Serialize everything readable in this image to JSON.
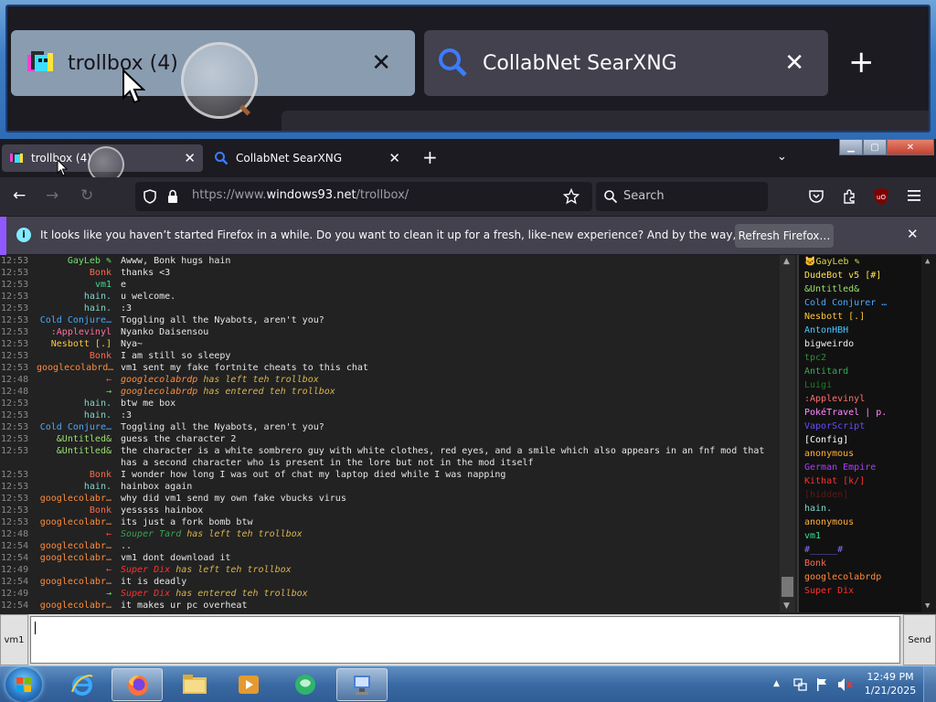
{
  "preview": {
    "tab1_title": "trollbox (4)",
    "tab2_title": "CollabNet SearXNG",
    "close": "✕",
    "newtab": "+"
  },
  "tabs": [
    {
      "title": "trollbox (4)",
      "active": true
    },
    {
      "title": "CollabNet SearXNG",
      "active": false
    }
  ],
  "tab_close": "✕",
  "newtab": "+",
  "listall": "⌄",
  "window_controls": {
    "min": "▁",
    "max": "▢",
    "close": "✕"
  },
  "nav": {
    "back": "←",
    "forward": "→",
    "reload": "↻",
    "url_prefix": "https://www.",
    "url_host": "windows93.net",
    "url_path": "/trollbox/",
    "search_placeholder": "Search"
  },
  "notification": {
    "text": "It looks like you haven’t started Firefox in a while. Do you want to clean it up for a fresh, like-new experience? And by the way, welcome back!",
    "button": "Refresh Firefox…",
    "close": "✕",
    "icon": "i"
  },
  "chat": [
    {
      "time": "12:53",
      "nick": "GayLeb ✎",
      "color": "#6ee06e",
      "text": "Awww, Bonk hugs hain"
    },
    {
      "time": "12:53",
      "nick": "Bonk",
      "color": "#ff6b4a",
      "text": "thanks <3"
    },
    {
      "time": "12:53",
      "nick": "vm1",
      "color": "#3ddc97",
      "text": "e"
    },
    {
      "time": "12:53",
      "nick": "hain.",
      "color": "#7fd6c8",
      "text": "u welcome."
    },
    {
      "time": "12:53",
      "nick": "hain.",
      "color": "#7fd6c8",
      "text": ":3"
    },
    {
      "time": "12:53",
      "nick": "Cold Conjure…",
      "color": "#4aa8ff",
      "text": "Toggling all the Nyabots, aren't you?"
    },
    {
      "time": "12:53",
      "nick": ":Applevinyl",
      "color": "#ff6fa0",
      "text": "Nyanko Daisensou"
    },
    {
      "time": "12:53",
      "nick": "Nesbott [.]",
      "color": "#ffc73d",
      "text": "Nya~"
    },
    {
      "time": "12:53",
      "nick": "Bonk",
      "color": "#ff6b4a",
      "text": "I am still so sleepy"
    },
    {
      "time": "12:53",
      "nick": "googlecolabrd…",
      "color": "#ff8c3b",
      "text": "vm1 sent my fake fortnite cheats to this chat"
    },
    {
      "time": "12:48",
      "nick": "←",
      "color": "#ff4a4a",
      "text": "",
      "sys_name": "googlecolabrdp",
      "sys_name_color": "#ff8c3b",
      "sys_text": " has left teh trollbox"
    },
    {
      "time": "12:48",
      "nick": "→",
      "color": "#6ee06e",
      "text": "",
      "sys_name": "googlecolabrdp",
      "sys_name_color": "#ff8c3b",
      "sys_text": " has entered teh trollbox"
    },
    {
      "time": "12:53",
      "nick": "hain.",
      "color": "#7fd6c8",
      "text": "btw me box"
    },
    {
      "time": "12:53",
      "nick": "hain.",
      "color": "#7fd6c8",
      "text": ":3"
    },
    {
      "time": "12:53",
      "nick": "Cold Conjure…",
      "color": "#4aa8ff",
      "text": "Toggling all the Nyabots, aren't you?"
    },
    {
      "time": "12:53",
      "nick": "&Untitled&",
      "color": "#9be06e",
      "text": "guess the character 2"
    },
    {
      "time": "12:53",
      "nick": "&Untitled&",
      "color": "#9be06e",
      "text": "the character is a white sombrero guy with white clothes, red eyes, and a smile which also appears in an fnf mod that has a second character who is present in the lore but not in the mod itself"
    },
    {
      "time": "12:53",
      "nick": "Bonk",
      "color": "#ff6b4a",
      "text": "I wonder how long I was out of chat my laptop died while I was napping"
    },
    {
      "time": "12:53",
      "nick": "hain.",
      "color": "#7fd6c8",
      "text": "hainbox again"
    },
    {
      "time": "12:53",
      "nick": "googlecolabr…",
      "color": "#ff8c3b",
      "text": "why did vm1 send my own fake vbucks virus"
    },
    {
      "time": "12:53",
      "nick": "Bonk",
      "color": "#ff6b4a",
      "text": "yesssss hainbox"
    },
    {
      "time": "12:53",
      "nick": "googlecolabr…",
      "color": "#ff8c3b",
      "text": "its just a fork bomb btw"
    },
    {
      "time": "12:48",
      "nick": "←",
      "color": "#ff4a4a",
      "text": "",
      "sys_name": "Souper Tard",
      "sys_name_color": "#3aa05a",
      "sys_text": " has left teh trollbox"
    },
    {
      "time": "12:54",
      "nick": "googlecolabr…",
      "color": "#ff8c3b",
      "text": ".."
    },
    {
      "time": "12:54",
      "nick": "googlecolabr…",
      "color": "#ff8c3b",
      "text": "vm1 dont download it"
    },
    {
      "time": "12:49",
      "nick": "←",
      "color": "#ff4a4a",
      "text": "",
      "sys_name": "Super Dix",
      "sys_name_color": "#ff3030",
      "sys_text": " has left teh trollbox"
    },
    {
      "time": "12:54",
      "nick": "googlecolabr…",
      "color": "#ff8c3b",
      "text": "it is deadly"
    },
    {
      "time": "12:49",
      "nick": "→",
      "color": "#6ee06e",
      "text": "",
      "sys_name": "Super Dix",
      "sys_name_color": "#ff3030",
      "sys_text": " has entered teh trollbox"
    },
    {
      "time": "12:54",
      "nick": "googlecolabr…",
      "color": "#ff8c3b",
      "text": "it makes ur pc overheat"
    }
  ],
  "users": [
    {
      "name": "🐱GayLeb ✎",
      "color": "#d6d64a"
    },
    {
      "name": "DudeBot v5 [#]",
      "color": "#ffe14a"
    },
    {
      "name": "&Untitled&",
      "color": "#9be06e"
    },
    {
      "name": "Cold Conjurer …",
      "color": "#4aa8ff"
    },
    {
      "name": "Nesbott [.]",
      "color": "#ffc73d"
    },
    {
      "name": "AntonHBH",
      "color": "#4ac8ff"
    },
    {
      "name": "bigweirdo",
      "color": "#f0f0f0"
    },
    {
      "name": "tpc2",
      "color": "#2e8b3a"
    },
    {
      "name": "Antitard",
      "color": "#3aa85a"
    },
    {
      "name": "Luigi",
      "color": "#1f7a2a"
    },
    {
      "name": ":Applevinyl",
      "color": "#ff6f6f"
    },
    {
      "name": "PokéTravel | p.",
      "color": "#ff8cff"
    },
    {
      "name": "VaporScript",
      "color": "#6a4aff"
    },
    {
      "name": "[Config]",
      "color": "#ffffff"
    },
    {
      "name": "anonymous",
      "color": "#ffb03b"
    },
    {
      "name": "German Empire",
      "color": "#b03bff"
    },
    {
      "name": "Kithat [k/]",
      "color": "#ff3030"
    },
    {
      "name": "[hidden]",
      "color": "#5a1a1a"
    },
    {
      "name": "hain.",
      "color": "#7fd6c8"
    },
    {
      "name": "anonymous",
      "color": "#ffb03b"
    },
    {
      "name": "vm1",
      "color": "#3ddc97"
    },
    {
      "name": "#_____#",
      "color": "#8a6aff"
    },
    {
      "name": "Bonk",
      "color": "#ff6b4a"
    },
    {
      "name": "googlecolabrdp",
      "color": "#ff8c3b"
    },
    {
      "name": "Super Dix",
      "color": "#ff3030"
    }
  ],
  "input": {
    "nick": "vm1",
    "value": "",
    "send": "Send"
  },
  "taskbar": {
    "time": "12:49 PM",
    "date": "1/21/2025",
    "icons": [
      "ie-icon",
      "firefox-icon",
      "explorer-icon",
      "media-player-icon",
      "messenger-icon",
      "network-app-icon"
    ]
  }
}
